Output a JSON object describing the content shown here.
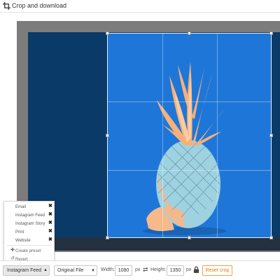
{
  "header": {
    "title": "Crop and download",
    "icon": "crop-icon"
  },
  "preset_menu": {
    "items": [
      {
        "label": "Email",
        "remove_icon": "close-icon"
      },
      {
        "label": "Instagram Feed",
        "remove_icon": "close-icon"
      },
      {
        "label": "Instagram Story",
        "remove_icon": "close-icon"
      },
      {
        "label": "Print",
        "remove_icon": "close-icon"
      },
      {
        "label": "Website",
        "remove_icon": "close-icon"
      }
    ],
    "actions": [
      {
        "label": "Create preset",
        "icon": "plus-icon"
      },
      {
        "label": "Revert",
        "icon": "undo-icon"
      }
    ]
  },
  "toolbar": {
    "preset_button": "Instagram Feed",
    "file_select": "Original File",
    "width_label": "Width:",
    "width_value": "1080",
    "width_unit": "px",
    "height_label": "Height:",
    "height_value": "1350",
    "height_unit": "px",
    "reset_label": "Reset crop",
    "accent_color": "#f0a33c"
  },
  "image": {
    "description_icon": "pineapple-image",
    "background_color": "#1e77d8"
  }
}
